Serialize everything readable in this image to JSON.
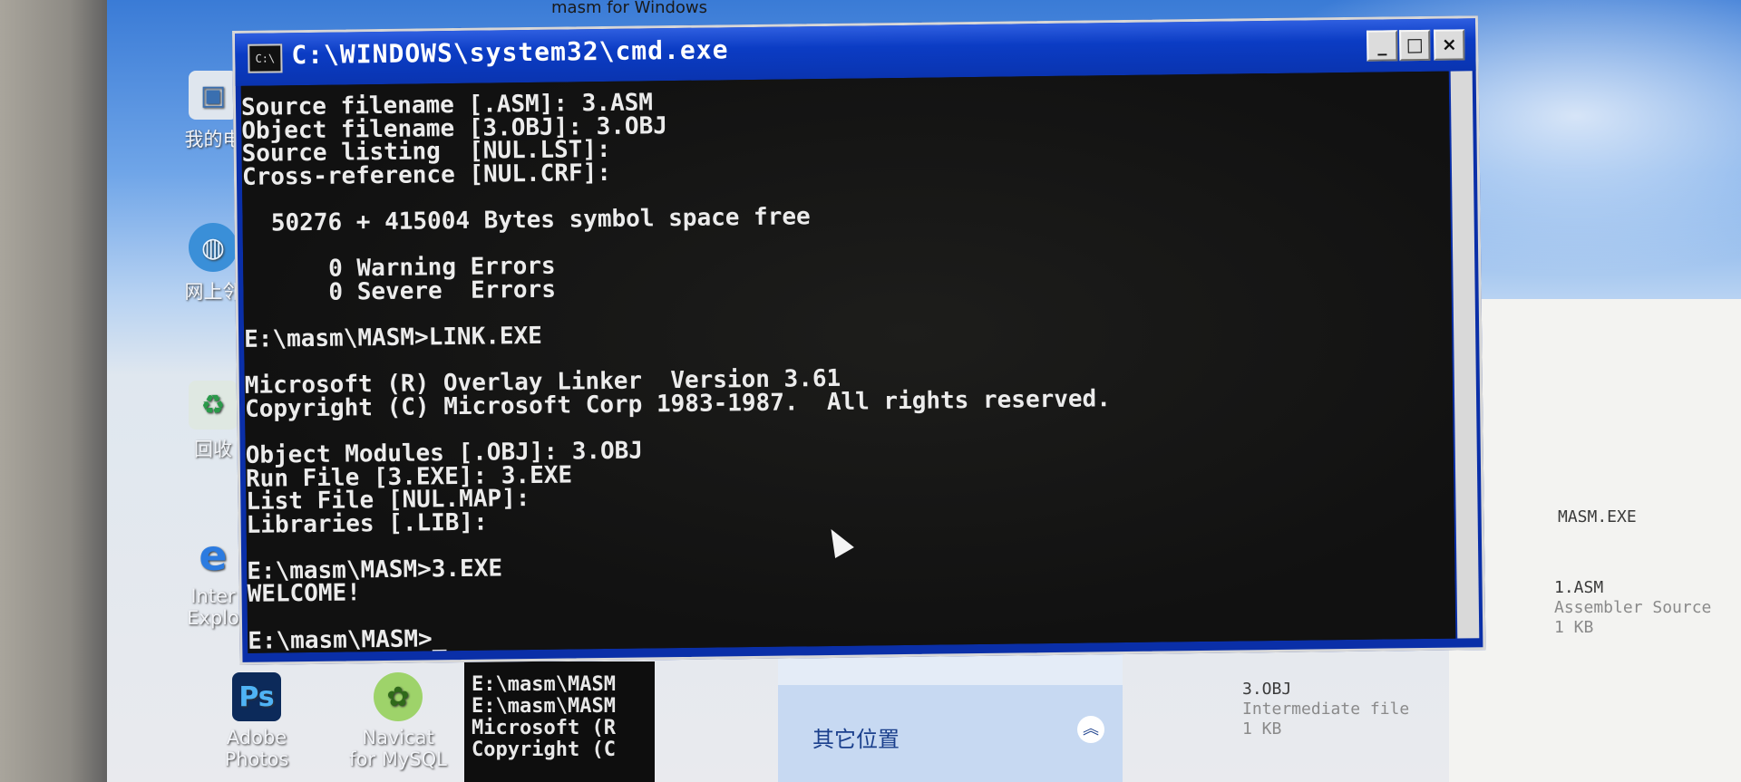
{
  "window": {
    "title": "C:\\WINDOWS\\system32\\cmd.exe",
    "icon_text": "C:\\",
    "buttons": {
      "minimize": "_",
      "maximize": "□",
      "close": "×"
    }
  },
  "console": {
    "lines": [
      "Source filename [.ASM]: 3.ASM",
      "Object filename [3.OBJ]: 3.OBJ",
      "Source listing  [NUL.LST]:",
      "Cross-reference [NUL.CRF]:",
      "",
      "  50276 + 415004 Bytes symbol space free",
      "",
      "      0 Warning Errors",
      "      0 Severe  Errors",
      "",
      "E:\\masm\\MASM>LINK.EXE",
      "",
      "Microsoft (R) Overlay Linker  Version 3.61",
      "Copyright (C) Microsoft Corp 1983-1987.  All rights reserved.",
      "",
      "Object Modules [.OBJ]: 3.OBJ",
      "Run File [3.EXE]: 3.EXE",
      "List File [NUL.MAP]:",
      "Libraries [.LIB]:",
      "",
      "E:\\masm\\MASM>3.EXE",
      "WELCOME!",
      "",
      "E:\\masm\\MASM>_"
    ]
  },
  "desktop_icons": [
    {
      "label": "我的电",
      "icon": "my-computer-icon"
    },
    {
      "label": "网上邻",
      "icon": "network-icon"
    },
    {
      "label": "回收",
      "icon": "recycle-bin-icon"
    },
    {
      "label": "Inter Explo",
      "icon": "internet-explorer-icon"
    },
    {
      "label": "Adobe Photos",
      "icon": "photoshop-icon",
      "glyph": "Ps"
    },
    {
      "label": "Navicat for MySQL",
      "icon": "navicat-icon"
    }
  ],
  "top_labels": [
    "masm for Windows"
  ],
  "explorer": {
    "files": [
      {
        "name": "MASM.EXE",
        "type": "",
        "size": ""
      },
      {
        "name": "1.ASM",
        "type": "Assembler Source",
        "size": "1 KB"
      },
      {
        "name": "3.OBJ",
        "type": "Intermediate file",
        "size": "1 KB"
      }
    ],
    "asm_logo": "asm",
    "other_places": "其它位置",
    "other_places_chevron": "︽"
  },
  "cmd_behind": {
    "lines": [
      "E:\\masm\\MASM",
      "",
      "E:\\masm\\MASM",
      "Microsoft (R",
      "Copyright (C"
    ]
  }
}
